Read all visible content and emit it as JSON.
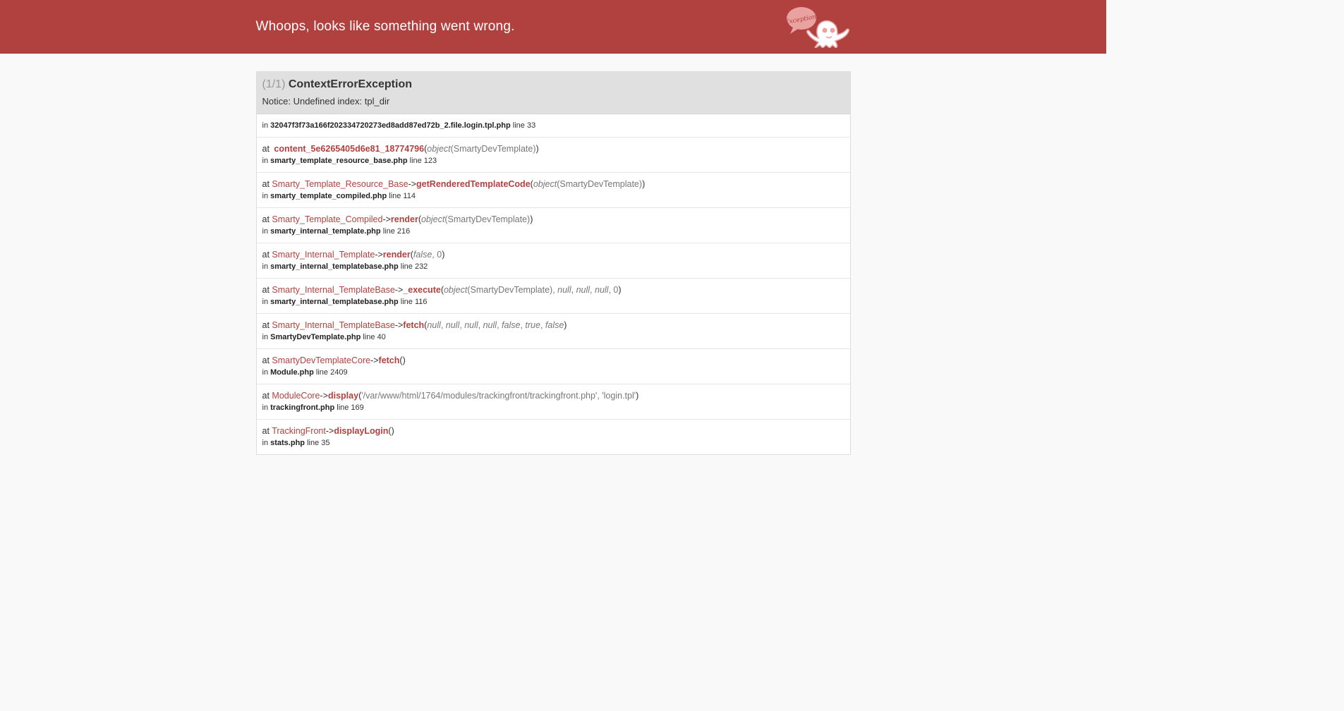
{
  "header": {
    "title": "Whoops, looks like something went wrong.",
    "logo_text": "Exception!"
  },
  "exception": {
    "count": "(1/1)",
    "name": "ContextErrorException",
    "message": "Notice: Undefined index: tpl_dir"
  },
  "origin": {
    "in_label": "in",
    "file": "32047f3f73a166f202334720273ed8add87ed72b_2.file.login.tpl.php",
    "line": "line 33"
  },
  "trace": [
    {
      "at": "at",
      "class": "",
      "arrow": "",
      "method": "content_5e6265405d6e81_18774796",
      "open": "(",
      "args_html": "<i>object</i>(SmartyDevTemplate)",
      "close": ")",
      "in": "in",
      "file": "smarty_template_resource_base.php",
      "line": "line 123"
    },
    {
      "at": "at",
      "class": "Smarty_Template_Resource_Base",
      "arrow": "->",
      "method": "getRenderedTemplateCode",
      "open": "(",
      "args_html": "<i>object</i>(SmartyDevTemplate)",
      "close": ")",
      "in": "in",
      "file": "smarty_template_compiled.php",
      "line": "line 114"
    },
    {
      "at": "at",
      "class": "Smarty_Template_Compiled",
      "arrow": "->",
      "method": "render",
      "open": "(",
      "args_html": "<i>object</i>(SmartyDevTemplate)",
      "close": ")",
      "in": "in",
      "file": "smarty_internal_template.php",
      "line": "line 216"
    },
    {
      "at": "at",
      "class": "Smarty_Internal_Template",
      "arrow": "->",
      "method": "render",
      "open": "(",
      "args_html": "<i>false</i>, 0",
      "close": ")",
      "in": "in",
      "file": "smarty_internal_templatebase.php",
      "line": "line 232"
    },
    {
      "at": "at",
      "class": "Smarty_Internal_TemplateBase",
      "arrow": "->",
      "method": "_execute",
      "open": "(",
      "args_html": "<i>object</i>(SmartyDevTemplate), <i>null</i>, <i>null</i>, <i>null</i>, 0",
      "close": ")",
      "in": "in",
      "file": "smarty_internal_templatebase.php",
      "line": "line 116"
    },
    {
      "at": "at",
      "class": "Smarty_Internal_TemplateBase",
      "arrow": "->",
      "method": "fetch",
      "open": "(",
      "args_html": "<i>null</i>, <i>null</i>, <i>null</i>, <i>null</i>, <i>false</i>, <i>true</i>, <i>false</i>",
      "close": ")",
      "in": "in",
      "file": "SmartyDevTemplate.php",
      "line": "line 40"
    },
    {
      "at": "at",
      "class": "SmartyDevTemplateCore",
      "arrow": "->",
      "method": "fetch",
      "open": "(",
      "args_html": "",
      "close": ")",
      "in": "in",
      "file": "Module.php",
      "line": "line 2409"
    },
    {
      "at": "at",
      "class": "ModuleCore",
      "arrow": "->",
      "method": "display",
      "open": "(",
      "args_html": "'/var/www/html/1764/modules/trackingfront/trackingfront.php', 'login.tpl'",
      "close": ")",
      "in": "in",
      "file": "trackingfront.php",
      "line": "line 169"
    },
    {
      "at": "at",
      "class": "TrackingFront",
      "arrow": "->",
      "method": "displayLogin",
      "open": "(",
      "args_html": "",
      "close": ")",
      "in": "in",
      "file": "stats.php",
      "line": "line 35"
    }
  ],
  "colors": {
    "header_bg": "#b0413e",
    "accent": "#b0413e",
    "page_bg": "#f9f9f9"
  }
}
